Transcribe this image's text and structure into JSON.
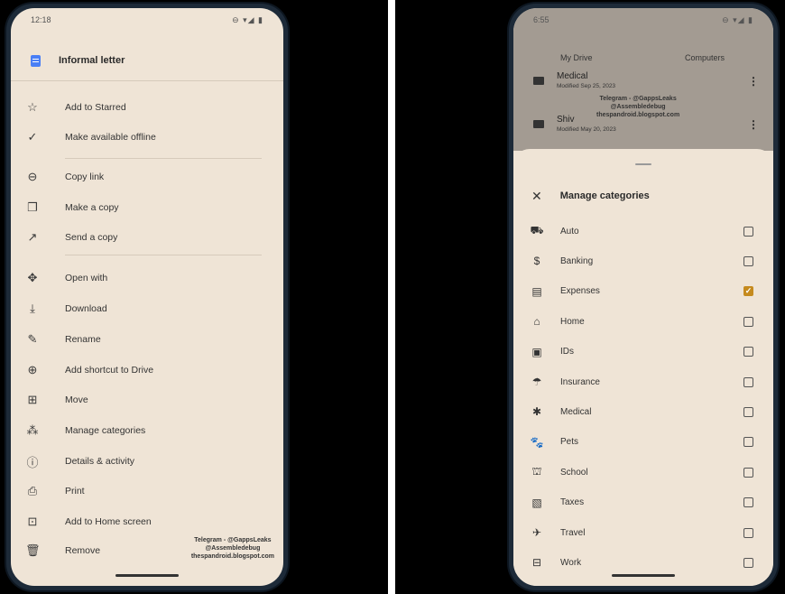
{
  "left_phone": {
    "status_time": "12:18",
    "status_icons": "⊖ ▾◢ ▮",
    "header_title": "Informal letter",
    "menu": [
      {
        "icon": "star-icon",
        "glyph": "☆",
        "label": "Add to Starred"
      },
      {
        "icon": "offline-icon",
        "glyph": "✓",
        "label": "Make available offline"
      },
      {
        "icon": "link-icon",
        "glyph": "⊖",
        "label": "Copy link"
      },
      {
        "icon": "copy-icon",
        "glyph": "❐",
        "label": "Make a copy"
      },
      {
        "icon": "send-icon",
        "glyph": "↗",
        "label": "Send a copy"
      },
      {
        "icon": "open-with-icon",
        "glyph": "✥",
        "label": "Open with"
      },
      {
        "icon": "download-icon",
        "glyph": "⤓",
        "label": "Download"
      },
      {
        "icon": "rename-icon",
        "glyph": "✎",
        "label": "Rename"
      },
      {
        "icon": "shortcut-icon",
        "glyph": "⊕",
        "label": "Add shortcut to Drive"
      },
      {
        "icon": "move-icon",
        "glyph": "⊞",
        "label": "Move"
      },
      {
        "icon": "categories-icon",
        "glyph": "⁂",
        "label": "Manage categories"
      },
      {
        "icon": "info-icon",
        "glyph": "ⓘ",
        "label": "Details & activity"
      },
      {
        "icon": "print-icon",
        "glyph": "⎙",
        "label": "Print"
      },
      {
        "icon": "home-screen-icon",
        "glyph": "⊡",
        "label": "Add to Home screen"
      },
      {
        "icon": "trash-icon",
        "glyph": "🗑",
        "label": "Remove"
      }
    ],
    "watermark": [
      "Telegram - @GappsLeaks",
      "@Assembledebug",
      "thespandroid.blogspot.com"
    ]
  },
  "right_phone": {
    "status_time": "6:55",
    "status_icons": "⊖ ▾◢ ▮",
    "tabs": [
      "My Drive",
      "Computers"
    ],
    "files": [
      {
        "name": "Medical",
        "modified": "Modified Sep 25, 2023"
      },
      {
        "name": "Shiv",
        "modified": "Modified May 20, 2023"
      }
    ],
    "watermark": [
      "Telegram - @GappsLeaks",
      "@Assembledebug",
      "thespandroid.blogspot.com"
    ],
    "sheet_title": "Manage categories",
    "categories": [
      {
        "icon": "car-icon",
        "glyph": "⛟",
        "label": "Auto",
        "checked": false
      },
      {
        "icon": "dollar-icon",
        "glyph": "$",
        "label": "Banking",
        "checked": false
      },
      {
        "icon": "receipt-icon",
        "glyph": "▤",
        "label": "Expenses",
        "checked": true
      },
      {
        "icon": "house-icon",
        "glyph": "⌂",
        "label": "Home",
        "checked": false
      },
      {
        "icon": "id-badge-icon",
        "glyph": "▣",
        "label": "IDs",
        "checked": false
      },
      {
        "icon": "umbrella-icon",
        "glyph": "☂",
        "label": "Insurance",
        "checked": false
      },
      {
        "icon": "asterisk-icon",
        "glyph": "✱",
        "label": "Medical",
        "checked": false
      },
      {
        "icon": "paw-icon",
        "glyph": "🐾",
        "label": "Pets",
        "checked": false
      },
      {
        "icon": "school-icon",
        "glyph": "⛫",
        "label": "School",
        "checked": false
      },
      {
        "icon": "tax-doc-icon",
        "glyph": "▧",
        "label": "Taxes",
        "checked": false
      },
      {
        "icon": "airplane-icon",
        "glyph": "✈",
        "label": "Travel",
        "checked": false
      },
      {
        "icon": "briefcase-icon",
        "glyph": "⊟",
        "label": "Work",
        "checked": false
      }
    ],
    "check_glyph": "✓"
  }
}
